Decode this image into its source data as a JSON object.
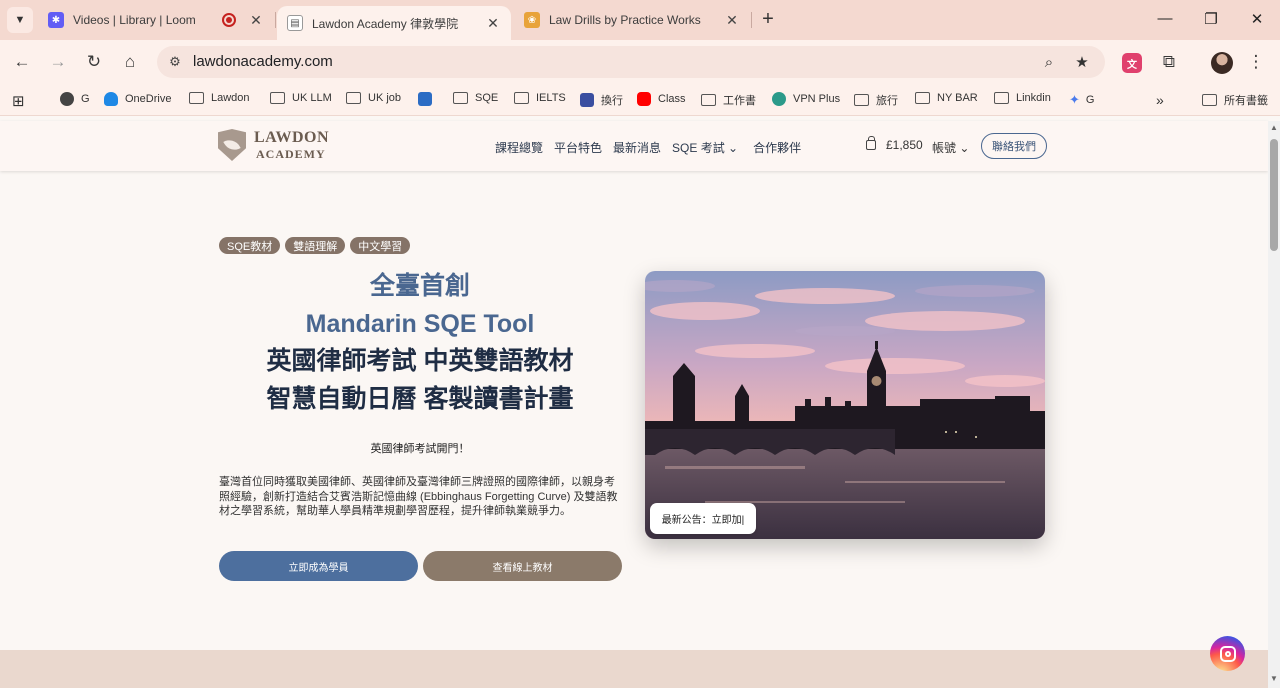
{
  "browser": {
    "tabs": [
      {
        "title": "Videos | Library | Loom",
        "active": false,
        "recording": true
      },
      {
        "title": "Lawdon Academy 律敦學院",
        "active": true
      },
      {
        "title": "Law Drills by Practice Works",
        "active": false
      }
    ],
    "url": "lawdonacademy.com",
    "bookmarks": [
      "G",
      "OneDrive",
      "Lawdon",
      "UK LLM",
      "UK job",
      "SQE",
      "IELTS",
      "換行",
      "Class",
      "工作書",
      "VPN Plus",
      "旅行",
      "NY BAR",
      "Linkdin",
      "G"
    ],
    "all_bookmarks_label": "所有書籤"
  },
  "site": {
    "logo": {
      "line1": "LAWDON",
      "line2": "ACADEMY"
    },
    "nav": [
      "課程總覽",
      "平台特色",
      "最新消息",
      "SQE 考試 ⌄",
      "合作夥伴"
    ],
    "cart_amount": "£1,850",
    "account_label": "帳號 ⌄",
    "contact_label": "聯絡我們"
  },
  "hero": {
    "tags": [
      "SQE教材",
      "雙語理解",
      "中文學習"
    ],
    "headline": [
      "全臺首創",
      "Mandarin SQE Tool",
      "英國律師考試 中英雙語教材",
      "智慧自動日曆 客製讀書計畫"
    ],
    "subhead": "英國律師考試開門！",
    "description": "臺灣首位同時獲取美國律師、英國律師及臺灣律師三牌證照的國際律師，以親身考照經驗，創新打造結合艾賓浩斯記憶曲線 (Ebbinghaus Forgetting Curve) 及雙語教材之學習系統，幫助華人學員精準規劃學習歷程，提升律師執業競爭力。",
    "primary_cta": "立即成為學員",
    "secondary_cta": "查看線上教材",
    "notice": "最新公告：立即加|"
  },
  "colors": {
    "tab_strip": "#f4d9d0",
    "primary_blue": "#4d6f9e",
    "secondary_brown": "#8b7a6a",
    "headline_blue": "#4a6790",
    "headline_dark": "#1f2d44"
  }
}
